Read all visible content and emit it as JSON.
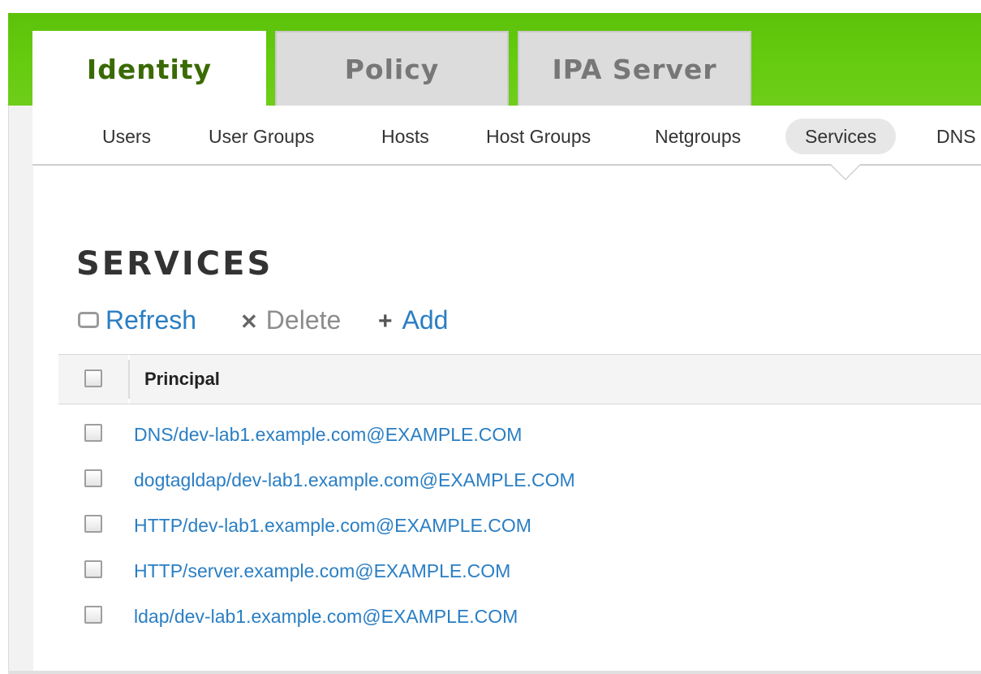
{
  "main_tabs": [
    {
      "label": "Identity",
      "active": true
    },
    {
      "label": "Policy",
      "active": false
    },
    {
      "label": "IPA Server",
      "active": false
    }
  ],
  "subnav": [
    {
      "label": "Users",
      "active": false
    },
    {
      "label": "User Groups",
      "active": false
    },
    {
      "label": "Hosts",
      "active": false
    },
    {
      "label": "Host Groups",
      "active": false
    },
    {
      "label": "Netgroups",
      "active": false
    },
    {
      "label": "Services",
      "active": true
    },
    {
      "label": "DNS",
      "active": false
    }
  ],
  "page": {
    "title": "SERVICES"
  },
  "actions": {
    "refresh": {
      "label": "Refresh",
      "icon": "refresh-icon",
      "enabled": true
    },
    "delete": {
      "label": "Delete",
      "icon": "x-icon",
      "enabled": false
    },
    "add": {
      "label": "Add",
      "icon": "plus-icon",
      "enabled": true
    }
  },
  "table": {
    "columns": [
      "Principal"
    ],
    "rows": [
      "DNS/dev-lab1.example.com@EXAMPLE.COM",
      "dogtagldap/dev-lab1.example.com@EXAMPLE.COM",
      "HTTP/dev-lab1.example.com@EXAMPLE.COM",
      "HTTP/server.example.com@EXAMPLE.COM",
      "ldap/dev-lab1.example.com@EXAMPLE.COM"
    ]
  },
  "colors": {
    "header_green": "#66cc10",
    "active_tab_text": "#3a6a04",
    "link": "#2a7ec3"
  }
}
